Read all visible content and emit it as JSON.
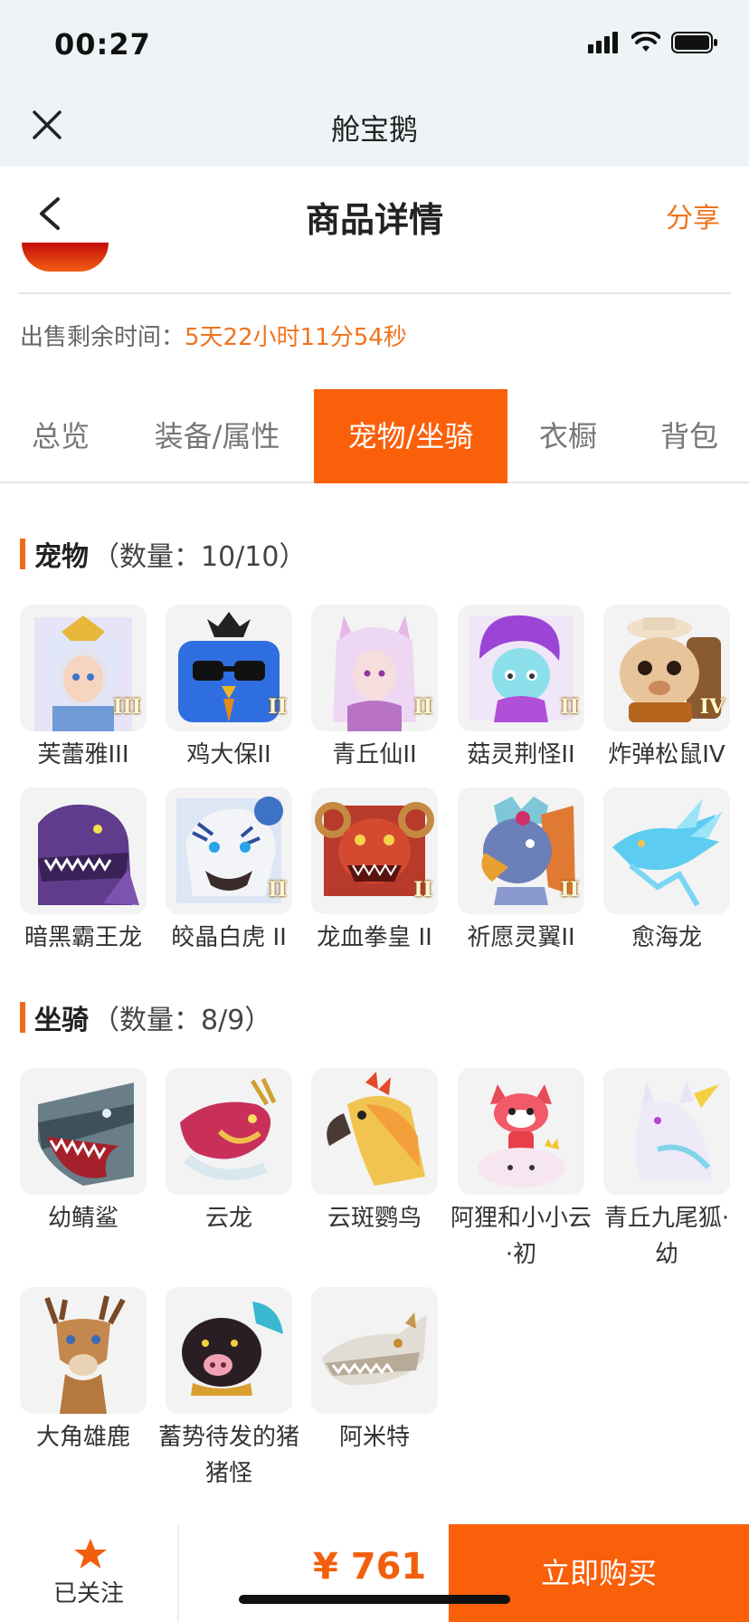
{
  "status_bar": {
    "time": "00:27"
  },
  "app_bar": {
    "title": "舱宝鹅"
  },
  "nav": {
    "title": "商品详情",
    "share": "分享"
  },
  "sale": {
    "label": "出售剩余时间：",
    "value": "5天22小时11分54秒"
  },
  "tabs": [
    {
      "label": "总览"
    },
    {
      "label": "装备/属性"
    },
    {
      "label": "宠物/坐骑",
      "active": true
    },
    {
      "label": "衣橱"
    },
    {
      "label": "背包"
    }
  ],
  "pets": {
    "title": "宠物",
    "count": "（数量：10/10）",
    "items": [
      {
        "name": "芙蕾雅III",
        "tier": "III"
      },
      {
        "name": "鸡大保II",
        "tier": "II"
      },
      {
        "name": "青丘仙II",
        "tier": "II"
      },
      {
        "name": "菇灵荆怪II",
        "tier": "II"
      },
      {
        "name": "炸弹松鼠IV",
        "tier": "IV"
      },
      {
        "name": "暗黑霸王龙",
        "tier": ""
      },
      {
        "name": "皎晶白虎 II",
        "tier": "II"
      },
      {
        "name": "龙血拳皇 II",
        "tier": "II"
      },
      {
        "name": "祈愿灵翼II",
        "tier": "II"
      },
      {
        "name": "愈海龙",
        "tier": ""
      }
    ]
  },
  "mounts": {
    "title": "坐骑",
    "count": "（数量：8/9）",
    "items": [
      {
        "name": "幼鲭鲨"
      },
      {
        "name": "云龙"
      },
      {
        "name": "云斑鹦鸟"
      },
      {
        "name": "阿狸和小小云·初"
      },
      {
        "name": "青丘九尾狐·幼"
      },
      {
        "name": "大角雄鹿"
      },
      {
        "name": "蓄势待发的猪猪怪"
      },
      {
        "name": "阿米特"
      }
    ]
  },
  "bottom_bar": {
    "follow_label": "已关注",
    "price": "¥ 761",
    "buy_label": "立即购买"
  },
  "colors": {
    "accent": "#fa5f0a",
    "accent_text": "#f0731e"
  }
}
